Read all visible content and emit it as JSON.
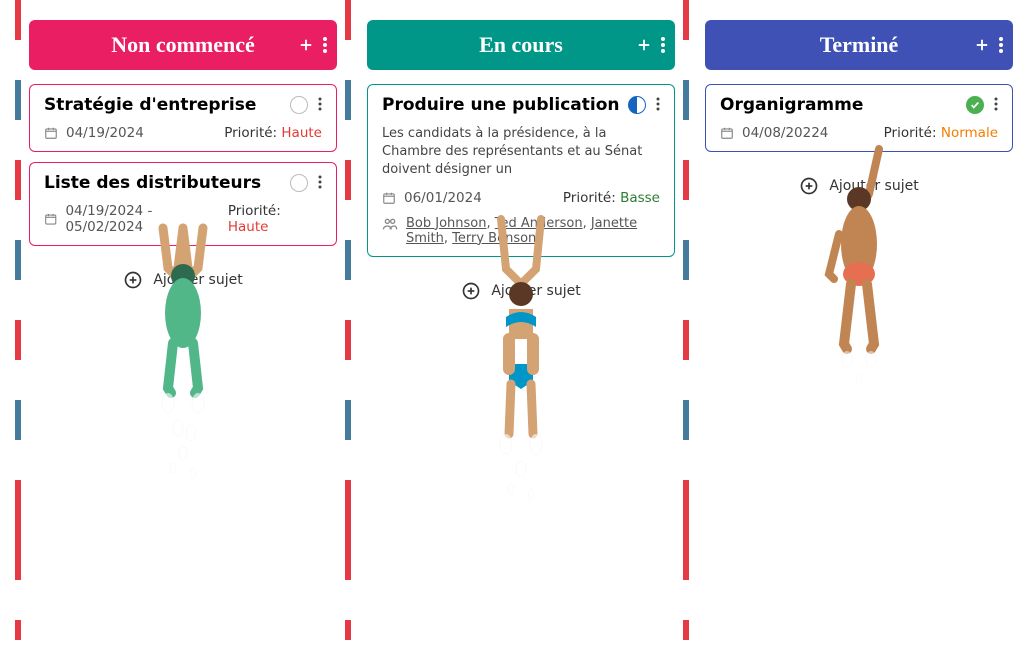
{
  "shared": {
    "add_subject": "Ajouter sujet",
    "priority_label": "Priorité: "
  },
  "columns": {
    "todo": {
      "title": "Non commencé"
    },
    "doing": {
      "title": "En cours"
    },
    "done": {
      "title": "Terminé"
    }
  },
  "cards": {
    "c1": {
      "title": "Stratégie d'entreprise",
      "date": "04/19/2024",
      "priority": "Haute"
    },
    "c2": {
      "title": "Liste des distributeurs",
      "date": "04/19/2024 - 05/02/2024",
      "priority": "Haute"
    },
    "c3": {
      "title": "Produire une publication",
      "desc": "Les candidats à la présidence, à la Chambre des représentants et au Sénat doivent désigner un",
      "date": "06/01/2024",
      "priority": "Basse",
      "assignees": {
        "a1": "Bob Johnson",
        "a2": "Ted Anderson",
        "a3": "Janette Smith",
        "a4": "Terry Benson"
      }
    },
    "c4": {
      "title": "Organigramme",
      "date": "04/08/20224",
      "priority": "Normale"
    }
  }
}
